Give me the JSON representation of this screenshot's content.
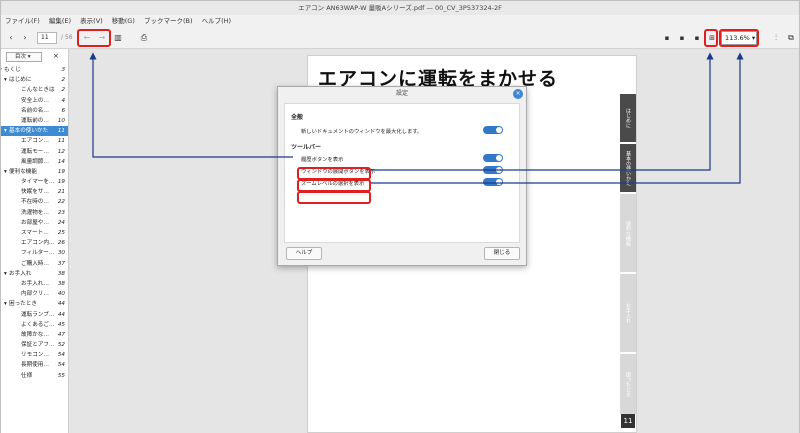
{
  "window": {
    "title": "エアコン AN63WAP-W 量販Aシリーズ.pdf — 00_CV_3P537324-2F"
  },
  "menu": [
    "ファイル(F)",
    "編集(E)",
    "表示(V)",
    "移動(G)",
    "ブックマーク(B)",
    "ヘルプ(H)"
  ],
  "toolbar": {
    "page": "11",
    "page_total": "/ 56",
    "zoom": "113.6%"
  },
  "sidebar": {
    "selector": "目次",
    "close": "×",
    "items": [
      {
        "label": "もくじ",
        "page": "3",
        "level": 0
      },
      {
        "label": "はじめに",
        "page": "2",
        "level": 1
      },
      {
        "label": "こんなときは",
        "page": "2",
        "level": 2
      },
      {
        "label": "安全上の…",
        "page": "4",
        "level": 2
      },
      {
        "label": "名前の名…",
        "page": "6",
        "level": 2
      },
      {
        "label": "運転前の…",
        "page": "10",
        "level": 2
      },
      {
        "label": "基本の使いかた",
        "page": "11",
        "level": 1,
        "selected": true
      },
      {
        "label": "エアコン…",
        "page": "11",
        "level": 2
      },
      {
        "label": "運転モー…",
        "page": "12",
        "level": 2
      },
      {
        "label": "風量調節…",
        "page": "14",
        "level": 2
      },
      {
        "label": "便利な機能",
        "page": "19",
        "level": 1
      },
      {
        "label": "タイマーを…",
        "page": "19",
        "level": 2
      },
      {
        "label": "快眠をサ…",
        "page": "21",
        "level": 2
      },
      {
        "label": "不在時の…",
        "page": "22",
        "level": 2
      },
      {
        "label": "洗濯物を…",
        "page": "23",
        "level": 2
      },
      {
        "label": "お部屋や…",
        "page": "24",
        "level": 2
      },
      {
        "label": "スマート…",
        "page": "25",
        "level": 2
      },
      {
        "label": "エアコン内…",
        "page": "26",
        "level": 2
      },
      {
        "label": "フィルター…",
        "page": "30",
        "level": 2
      },
      {
        "label": "ご購入時…",
        "page": "37",
        "level": 2
      },
      {
        "label": "お手入れ",
        "page": "38",
        "level": 1
      },
      {
        "label": "お手入れ…",
        "page": "38",
        "level": 2
      },
      {
        "label": "内部クリ…",
        "page": "40",
        "level": 2
      },
      {
        "label": "困ったとき",
        "page": "44",
        "level": 1
      },
      {
        "label": "運転ランプ…",
        "page": "44",
        "level": 2
      },
      {
        "label": "よくあるご…",
        "page": "45",
        "level": 2
      },
      {
        "label": "故障かな…",
        "page": "47",
        "level": 2
      },
      {
        "label": "保証とアフ…",
        "page": "52",
        "level": 2
      },
      {
        "label": "リモコン…",
        "page": "54",
        "level": 2
      },
      {
        "label": "長期使用…",
        "page": "54",
        "level": 2
      },
      {
        "label": "仕様",
        "page": "55",
        "level": 2
      }
    ]
  },
  "document": {
    "title": "エアコンに運転をまかせる",
    "tabs": [
      "はじめに",
      "基本の使いかた",
      "便利な機能",
      "お手入れ",
      "困ったとき"
    ],
    "page_number": "11"
  },
  "dialog": {
    "title": "設定",
    "close": "×",
    "general_heading": "全般",
    "general_option": "新しいドキュメントのウィンドウを最大化します。",
    "toolbar_heading": "ツールバー",
    "toolbar_options": [
      "履歴ボタンを表示",
      "ウィンドウの展開ボタンを表示",
      "ズームレベルの選択を表示"
    ],
    "help_button": "ヘルプ",
    "close_button": "閉じる"
  },
  "colors": {
    "accent": "#3479c8",
    "highlight": "#e02020",
    "arrow": "#1a3a8a",
    "selected": "#3d8bd3"
  }
}
